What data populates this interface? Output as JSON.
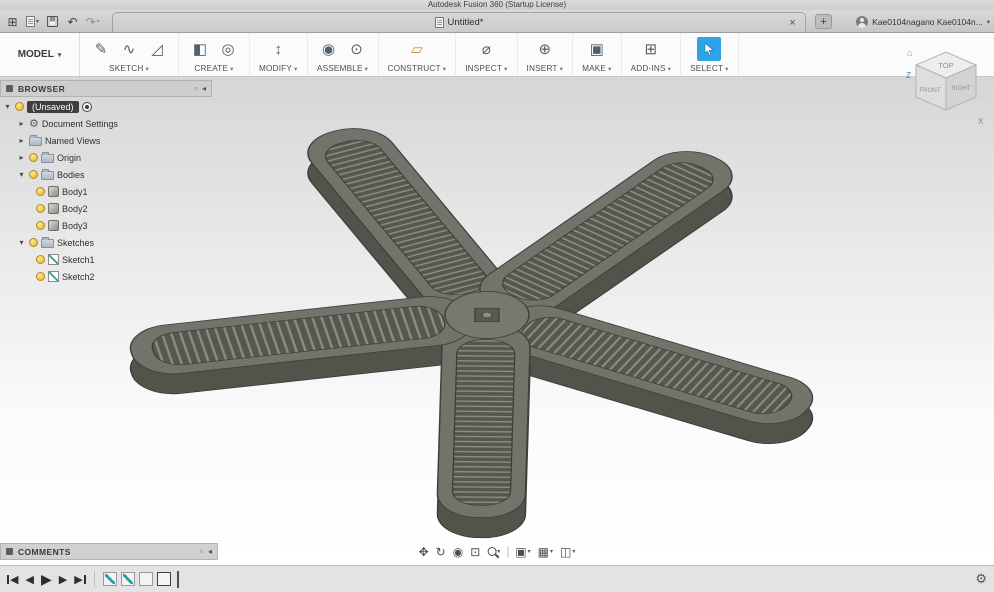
{
  "titlebar": {
    "title": "Autodesk Fusion 360 (Startup License)"
  },
  "tabbar": {
    "tab_title": "Untitled*",
    "account_name": "Kae0104nagano Kae0104n...",
    "icons": {
      "grid": "⊞",
      "undo": "↶",
      "redo": "↷",
      "close": "×",
      "add": "+"
    }
  },
  "ribbon": {
    "model_label": "MODEL",
    "groups": [
      {
        "label": "SKETCH",
        "icons": [
          {
            "name": "create-sketch",
            "glyph": "✎"
          },
          {
            "name": "spline",
            "glyph": "∿"
          },
          {
            "name": "line",
            "glyph": "◿"
          }
        ]
      },
      {
        "label": "CREATE",
        "icons": [
          {
            "name": "extrude",
            "glyph": "◧"
          },
          {
            "name": "revolve",
            "glyph": "◎"
          }
        ]
      },
      {
        "label": "MODIFY",
        "icons": [
          {
            "name": "press-pull",
            "glyph": "↕"
          }
        ]
      },
      {
        "label": "ASSEMBLE",
        "icons": [
          {
            "name": "new-component",
            "glyph": "◉"
          },
          {
            "name": "joint",
            "glyph": "⊙"
          }
        ]
      },
      {
        "label": "CONSTRUCT",
        "icons": [
          {
            "name": "construction-plane",
            "glyph": "▱"
          }
        ]
      },
      {
        "label": "INSPECT",
        "icons": [
          {
            "name": "measure",
            "glyph": "⌀"
          }
        ]
      },
      {
        "label": "INSERT",
        "icons": [
          {
            "name": "insert-mesh",
            "glyph": "⊕"
          }
        ]
      },
      {
        "label": "MAKE",
        "icons": [
          {
            "name": "print-3d",
            "glyph": "▣"
          }
        ]
      },
      {
        "label": "ADD-INS",
        "icons": [
          {
            "name": "scripts-addins",
            "glyph": "⊞"
          }
        ]
      },
      {
        "label": "SELECT",
        "icons": [
          {
            "name": "select-cursor",
            "glyph": ""
          }
        ]
      }
    ]
  },
  "browser": {
    "header": "BROWSER",
    "tree": [
      {
        "label": "(Unsaved)"
      },
      {
        "label": "Document Settings"
      },
      {
        "label": "Named Views"
      },
      {
        "label": "Origin"
      },
      {
        "label": "Bodies"
      },
      {
        "label": "Body1"
      },
      {
        "label": "Body2"
      },
      {
        "label": "Body3"
      },
      {
        "label": "Sketches"
      },
      {
        "label": "Sketch1"
      },
      {
        "label": "Sketch2"
      }
    ]
  },
  "viewcube": {
    "top": "TOP",
    "front": "FRONT",
    "right": "RIGHT",
    "axis_z": "Z",
    "axis_x": "X",
    "home": "⌂"
  },
  "comments": {
    "header": "COMMENTS"
  },
  "navbar": {
    "icons": {
      "pan": "✥",
      "orbit": "↻",
      "look_at": "◉",
      "zoom_window": "⊡",
      "display": "▣",
      "grid": "▦",
      "viewports": "◫"
    }
  },
  "timeline": {
    "controls": {
      "skip_start": "◀",
      "step_back": "◀",
      "play": "▶",
      "step_forward": "▶",
      "skip_end": "▶"
    },
    "gear": "⚙"
  },
  "colors": {
    "select_blue": "#2ea3e6",
    "model_top": "#73736c",
    "model_side": "#53534c"
  }
}
